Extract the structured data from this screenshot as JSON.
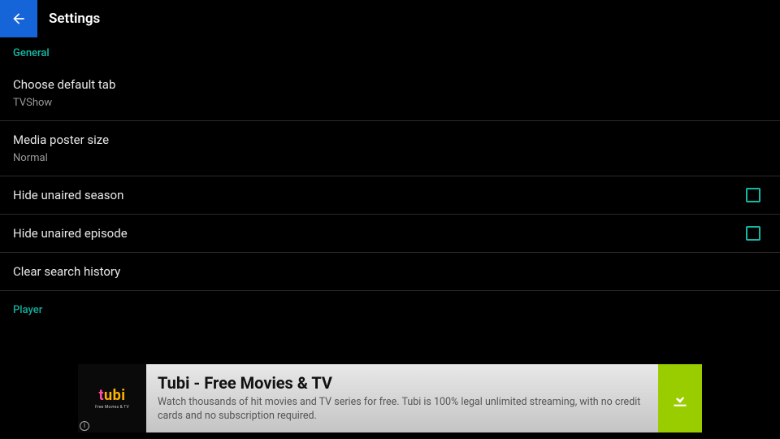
{
  "header": {
    "title": "Settings"
  },
  "sections": {
    "general": {
      "label": "General",
      "items": {
        "default_tab": {
          "title": "Choose default tab",
          "sub": "TVShow"
        },
        "poster_size": {
          "title": "Media poster size",
          "sub": "Normal"
        },
        "hide_unaired_season": {
          "title": "Hide unaired season"
        },
        "hide_unaired_episode": {
          "title": "Hide unaired episode"
        },
        "clear_search": {
          "title": "Clear search history"
        }
      }
    },
    "player": {
      "label": "Player"
    }
  },
  "ad": {
    "brand_prefix": "t",
    "brand_suffix": "ubi",
    "brand_tag": "Free Movies & TV",
    "title": "Tubi - Free Movies & TV",
    "desc": "Watch thousands of hit movies and TV series for free. Tubi is 100% legal unlimited streaming, with no credit cards and no subscription required."
  }
}
